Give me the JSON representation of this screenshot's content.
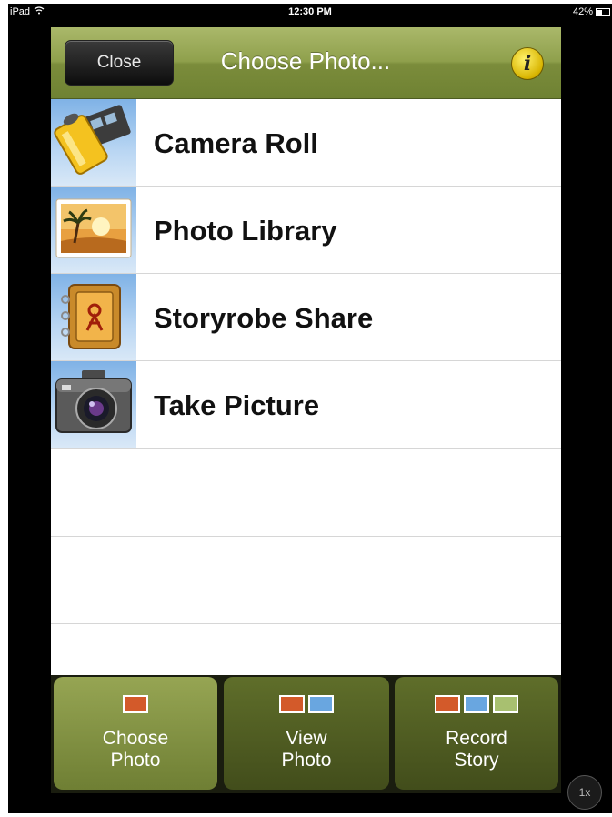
{
  "status_bar": {
    "device": "iPad",
    "time": "12:30 PM",
    "battery": "42%"
  },
  "navbar": {
    "close_label": "Close",
    "title": "Choose Photo...",
    "info_icon": "i"
  },
  "list": {
    "items": [
      {
        "label": "Camera Roll",
        "icon": "film-roll-icon"
      },
      {
        "label": "Photo Library",
        "icon": "photo-library-icon"
      },
      {
        "label": "Storyrobe Share",
        "icon": "storyrobe-share-icon"
      },
      {
        "label": "Take Picture",
        "icon": "camera-icon"
      }
    ]
  },
  "tabs": [
    {
      "line1": "Choose",
      "line2": "Photo",
      "active": true,
      "swatches": [
        "#d35a2a"
      ]
    },
    {
      "line1": "View",
      "line2": "Photo",
      "active": false,
      "swatches": [
        "#d35a2a",
        "#69a6e0"
      ]
    },
    {
      "line1": "Record",
      "line2": "Story",
      "active": false,
      "swatches": [
        "#d35a2a",
        "#69a6e0",
        "#a8c070"
      ]
    }
  ],
  "zoom_button": "1x",
  "colors": {
    "navbar": "#8fa04c",
    "tab_active": "#8a9a4a",
    "tab_inactive": "#4f5b22"
  }
}
